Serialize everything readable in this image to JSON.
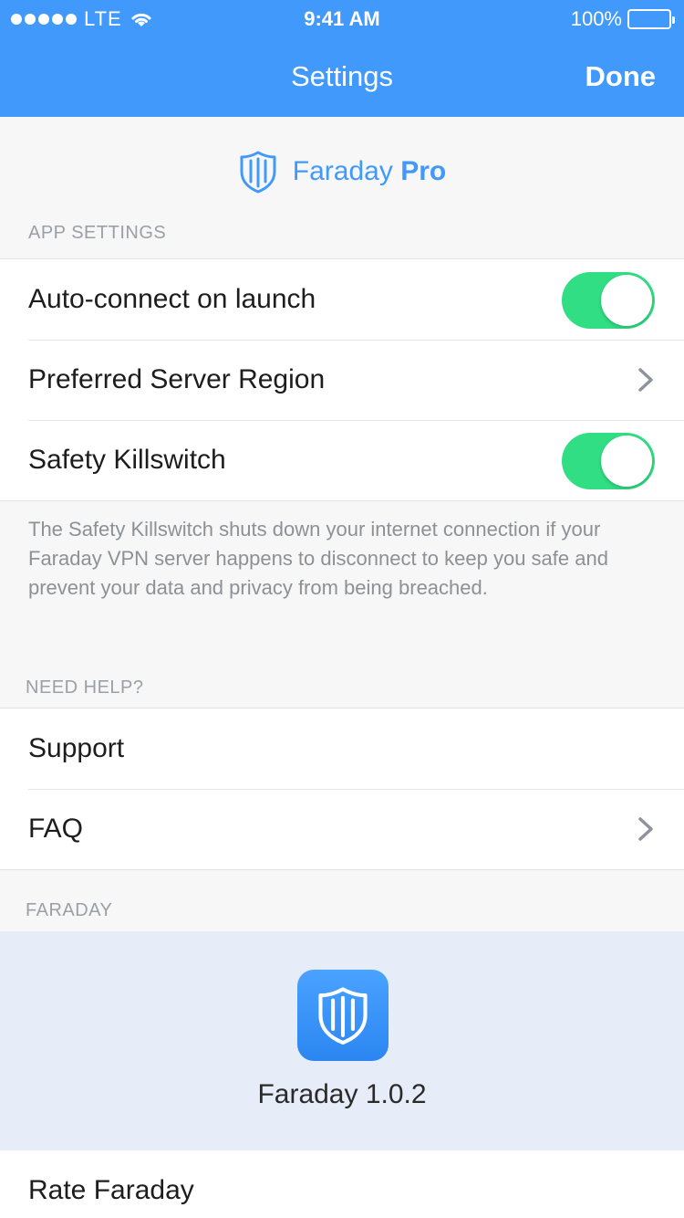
{
  "status_bar": {
    "carrier": "LTE",
    "time": "9:41 AM",
    "battery": "100%"
  },
  "nav": {
    "title": "Settings",
    "done_label": "Done"
  },
  "brand": {
    "name": "Faraday",
    "tier": "Pro",
    "icon": "shield-icon"
  },
  "app_settings": {
    "header": "APP SETTINGS",
    "rows": [
      {
        "label": "Auto-connect on launch",
        "control": "toggle",
        "on": true
      },
      {
        "label": "Preferred Server Region",
        "control": "chevron"
      },
      {
        "label": "Safety Killswitch",
        "control": "toggle",
        "on": true
      }
    ],
    "footnote": "The Safety Killswitch shuts down your internet connection if your Faraday VPN server happens to disconnect to keep you safe and prevent your data and privacy from being breached."
  },
  "need_help": {
    "header": "NEED HELP?",
    "rows": [
      {
        "label": "Support",
        "control": "none"
      },
      {
        "label": "FAQ",
        "control": "chevron"
      }
    ]
  },
  "faraday": {
    "header": "FARADAY",
    "version_text": "Faraday 1.0.2",
    "rate_label": "Rate Faraday"
  },
  "colors": {
    "accent": "#4199fb",
    "toggle_on": "#32de84",
    "about_bg": "#e6edf8"
  }
}
